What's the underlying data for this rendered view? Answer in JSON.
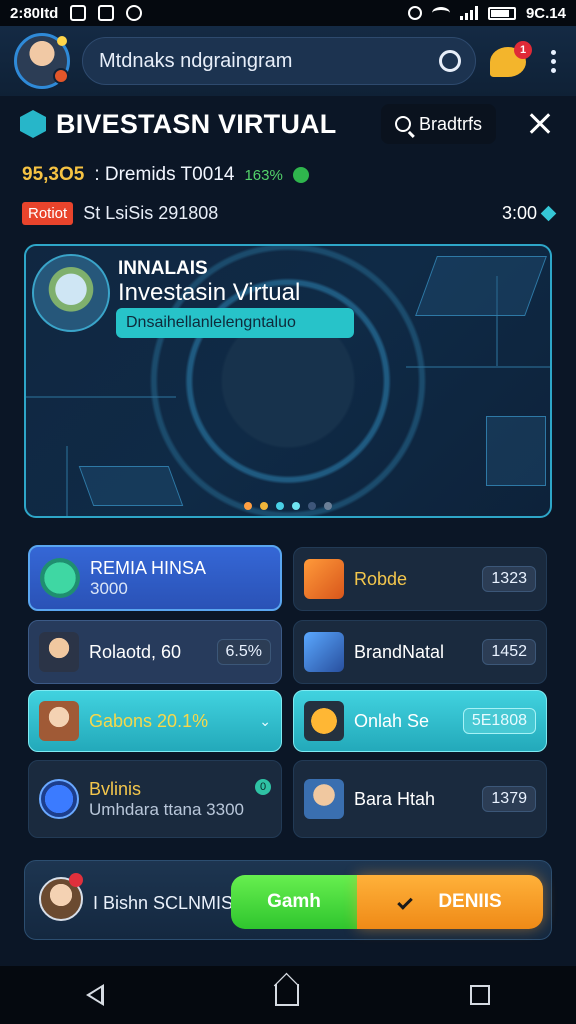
{
  "status_bar": {
    "left_text": "2:80Itd",
    "time": "9C.14"
  },
  "header": {
    "search_text": "Mtdnaks ndgraingram",
    "chat_badge": "1"
  },
  "title_row": {
    "title": "BIVESTASN VIRTUAL",
    "filter_label": "Bradtrfs"
  },
  "stats": {
    "value": "95,3O5",
    "label": ": Dremids T0014",
    "percent": "163%"
  },
  "info": {
    "tag": "Rotiot",
    "text": "St LsiSis 291808",
    "right_value": "3:00"
  },
  "hero": {
    "kicker": "INNALAIS",
    "title": "Investasin Virtual",
    "pill": "Dnsaihellanlelengntaluo"
  },
  "cards": [
    {
      "title": "REMIA HINSA",
      "sub": "3000",
      "value": ""
    },
    {
      "title": "Robde",
      "sub": "",
      "value": "1323"
    },
    {
      "title": "Rolaotd, 60",
      "sub": "",
      "value": "6.5%"
    },
    {
      "title": "BrandNatal",
      "sub": "",
      "value": "1452"
    },
    {
      "title": "Gabons 20.1%",
      "sub": "",
      "value": ""
    },
    {
      "title": "Onlah Se",
      "sub": "",
      "value": "5E1808"
    },
    {
      "title": "Bvlinis",
      "sub": "Umhdara ttana 3300",
      "value": "0"
    },
    {
      "title": "Bara Htah",
      "sub": "",
      "value": "1379"
    }
  ],
  "bottom": {
    "label": "I Bishn SCLNMIS",
    "primary_button": "Gamh",
    "secondary_button": "DENIIS"
  }
}
